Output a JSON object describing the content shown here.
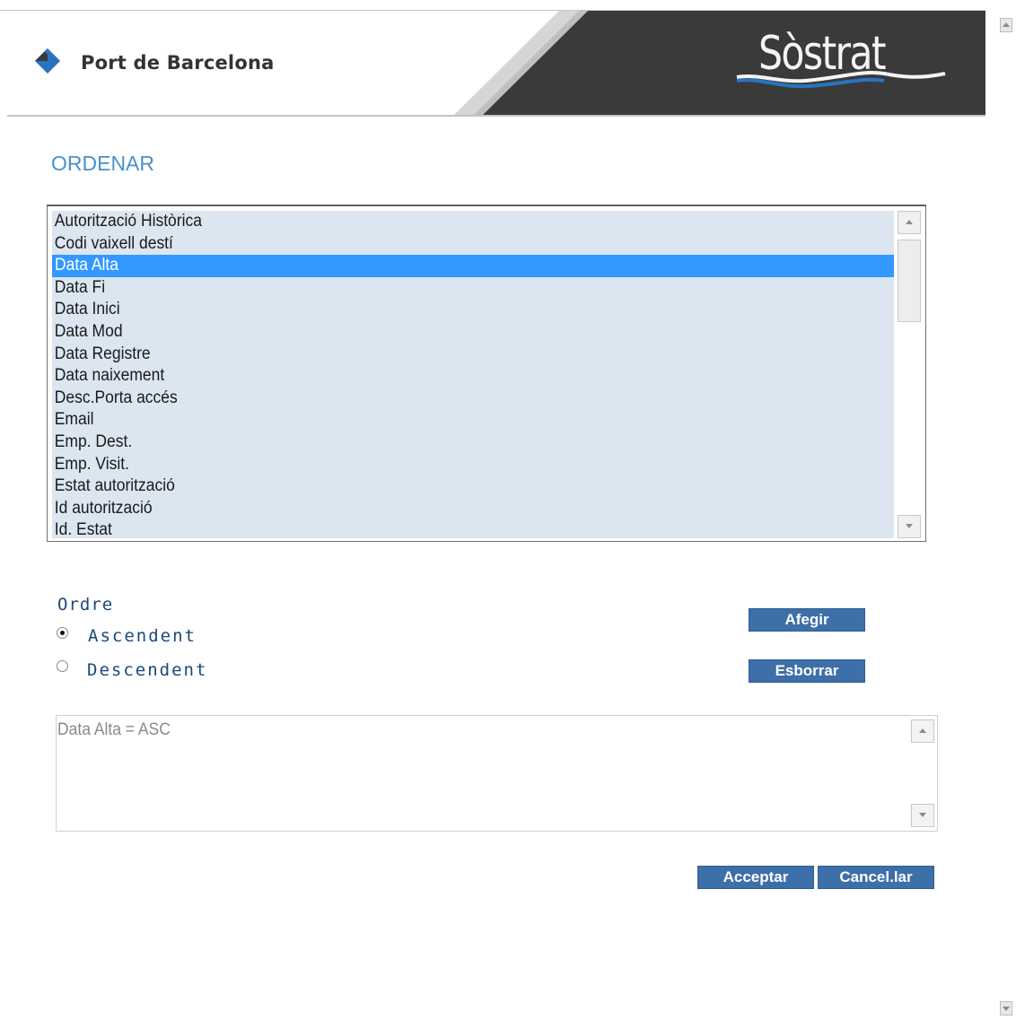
{
  "header": {
    "logo_text": "Port de Barcelona",
    "brand": "Sòstrat",
    "accent_color": "#2a73c1",
    "banner_color": "#3a3a3a"
  },
  "page": {
    "title": "ORDENAR"
  },
  "fields": {
    "items": [
      "Autorització Històrica",
      "Codi vaixell destí",
      "Data Alta",
      "Data Fi",
      "Data Inici",
      "Data Mod",
      "Data Registre",
      "Data naixement",
      "Desc.Porta accés",
      "Email",
      "Emp. Dest.",
      "Emp. Visit.",
      "Estat autorització",
      "Id autorització",
      "Id. Estat"
    ],
    "selected": "Data Alta"
  },
  "order": {
    "label": "Ordre",
    "ascendent": "Ascendent",
    "descendent": "Descendent",
    "selected": "Ascendent"
  },
  "buttons": {
    "add": "Afegir",
    "delete": "Esborrar",
    "accept": "Acceptar",
    "cancel": "Cancel.lar"
  },
  "result": {
    "text": "Data Alta = ASC"
  },
  "colors": {
    "title": "#4a90c8",
    "list_bg": "#dbe6f1",
    "selection": "#3399ff",
    "button": "#3d6fa8"
  }
}
